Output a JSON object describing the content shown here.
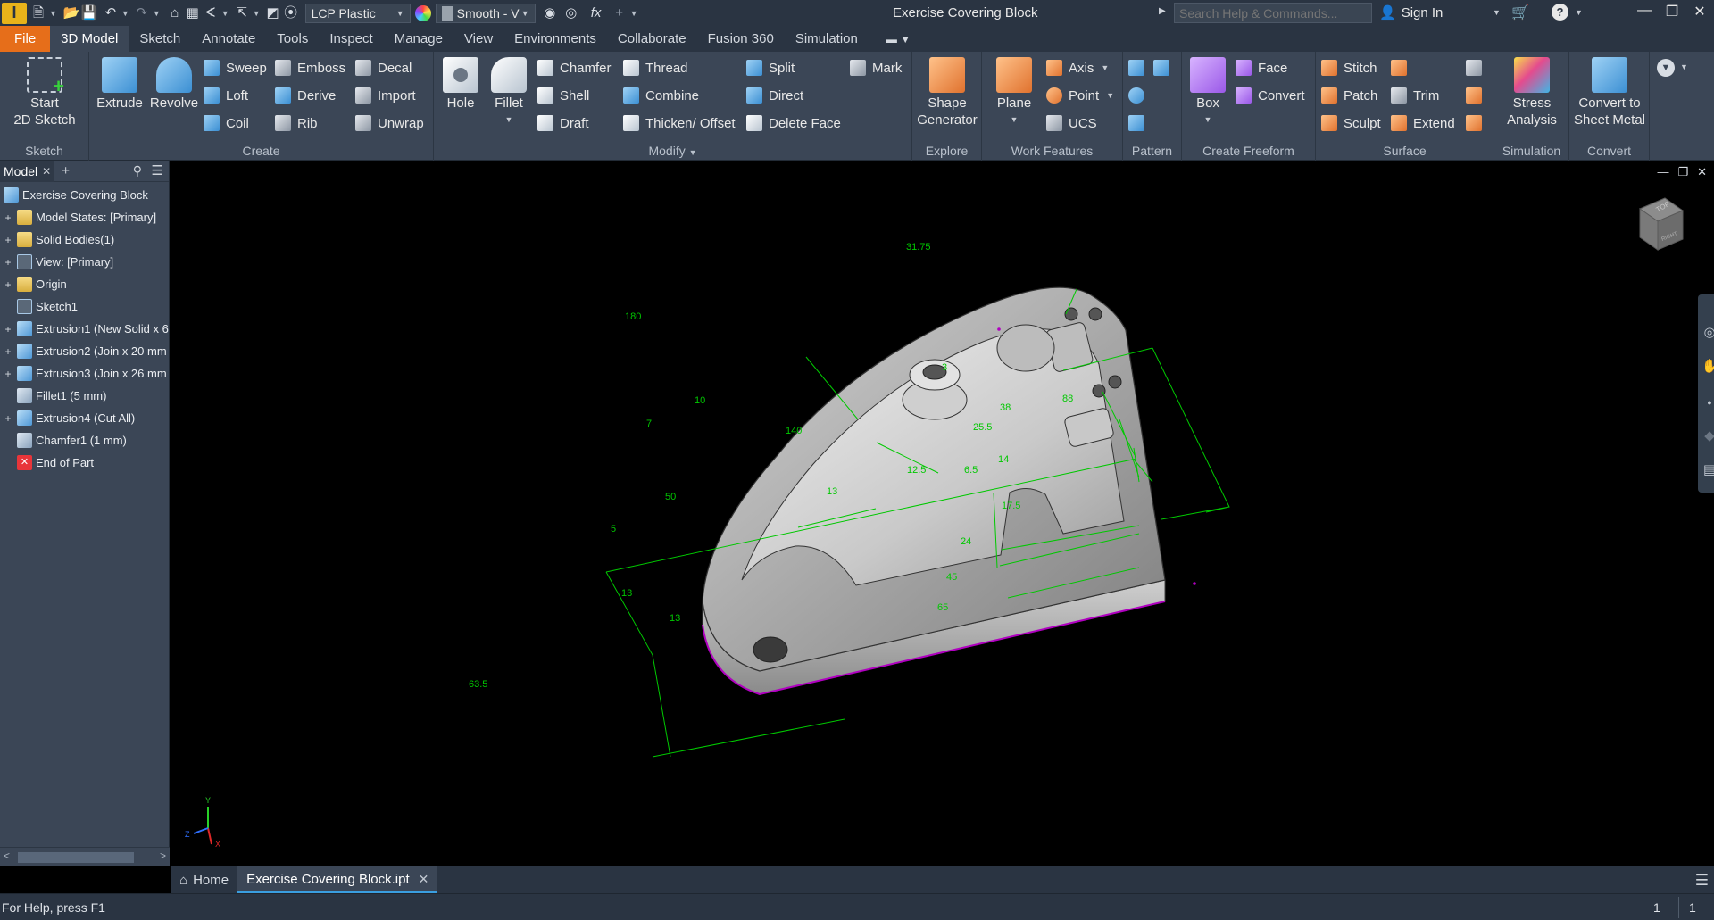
{
  "titlebar": {
    "app_letter": "I",
    "material": "LCP Plastic",
    "appearance": "Smooth - V",
    "document_title": "Exercise Covering Block",
    "search_placeholder": "Search Help & Commands...",
    "sign_in": "Sign In",
    "fx_label": "fx"
  },
  "tabs": [
    "File",
    "3D Model",
    "Sketch",
    "Annotate",
    "Tools",
    "Inspect",
    "Manage",
    "View",
    "Environments",
    "Collaborate",
    "Fusion 360",
    "Simulation"
  ],
  "active_tab": "3D Model",
  "ribbon": {
    "sketch": {
      "label": "Sketch",
      "start_line1": "Start",
      "start_line2": "2D Sketch"
    },
    "create": {
      "label": "Create",
      "extrude": "Extrude",
      "revolve": "Revolve",
      "sweep": "Sweep",
      "loft": "Loft",
      "coil": "Coil",
      "emboss": "Emboss",
      "derive": "Derive",
      "rib": "Rib",
      "decal": "Decal",
      "import": "Import",
      "unwrap": "Unwrap"
    },
    "modify": {
      "label": "Modify",
      "hole": "Hole",
      "fillet": "Fillet",
      "chamfer": "Chamfer",
      "shell": "Shell",
      "draft": "Draft",
      "thread": "Thread",
      "combine": "Combine",
      "thicken": "Thicken/ Offset",
      "split": "Split",
      "direct": "Direct",
      "delete_face": "Delete Face",
      "mark": "Mark"
    },
    "explore": {
      "label": "Explore",
      "shape_line1": "Shape",
      "shape_line2": "Generator"
    },
    "work": {
      "label": "Work Features",
      "plane": "Plane",
      "axis": "Axis",
      "point": "Point",
      "ucs": "UCS"
    },
    "pattern": {
      "label": "Pattern"
    },
    "freeform": {
      "label": "Create Freeform",
      "box": "Box",
      "face": "Face",
      "convert": "Convert"
    },
    "surface": {
      "label": "Surface",
      "stitch": "Stitch",
      "patch": "Patch",
      "sculpt": "Sculpt",
      "trim": "Trim",
      "extend": "Extend"
    },
    "simulation": {
      "label": "Simulation",
      "stress_line1": "Stress",
      "stress_line2": "Analysis"
    },
    "convert": {
      "label": "Convert",
      "convert_line1": "Convert to",
      "convert_line2": "Sheet Metal"
    }
  },
  "browser": {
    "tab_label": "Model",
    "items": [
      {
        "label": "Exercise Covering Block",
        "icon": "part-icon",
        "expand": ""
      },
      {
        "label": "Model States: [Primary]",
        "icon": "folder-icon",
        "expand": "+"
      },
      {
        "label": "Solid Bodies(1)",
        "icon": "folder-icon",
        "expand": "+"
      },
      {
        "label": "View: [Primary]",
        "icon": "view-icon",
        "expand": "+"
      },
      {
        "label": "Origin",
        "icon": "folder-icon",
        "expand": "+"
      },
      {
        "label": "Sketch1",
        "icon": "sketch-icon",
        "expand": ""
      },
      {
        "label": "Extrusion1 (New Solid x 6",
        "icon": "extrusion-icon",
        "expand": "+"
      },
      {
        "label": "Extrusion2 (Join x 20 mm",
        "icon": "extrusion-icon",
        "expand": "+"
      },
      {
        "label": "Extrusion3 (Join x 26 mm",
        "icon": "extrusion-icon",
        "expand": "+"
      },
      {
        "label": "Fillet1 (5 mm)",
        "icon": "fillet-icon",
        "expand": ""
      },
      {
        "label": "Extrusion4 (Cut All)",
        "icon": "extrusion-icon",
        "expand": "+"
      },
      {
        "label": "Chamfer1 (1 mm)",
        "icon": "chamfer-icon",
        "expand": ""
      },
      {
        "label": "End of Part",
        "icon": "end-of-part-icon",
        "expand": ""
      }
    ]
  },
  "viewport": {
    "viewcube_top": "TOP",
    "viewcube_front": "RIGHT",
    "dimensions": [
      "31.75",
      "180",
      "10",
      "140",
      "50",
      "5",
      "13",
      "13",
      "63.5",
      "88",
      "38",
      "25.5",
      "14",
      "17.5",
      "24",
      "45",
      "65",
      "6.5",
      "3",
      "13",
      "12.5",
      "7"
    ],
    "axis_labels": {
      "x": "X",
      "y": "Y",
      "z": "Z"
    }
  },
  "doctabs": {
    "home": "Home",
    "document": "Exercise Covering Block.ipt"
  },
  "status": {
    "help_text": "For Help, press F1",
    "count1": "1",
    "count2": "1"
  },
  "colors": {
    "accent_file": "#e66e1a",
    "dimension_green": "#00c800",
    "edge_purple": "#b000c0"
  }
}
